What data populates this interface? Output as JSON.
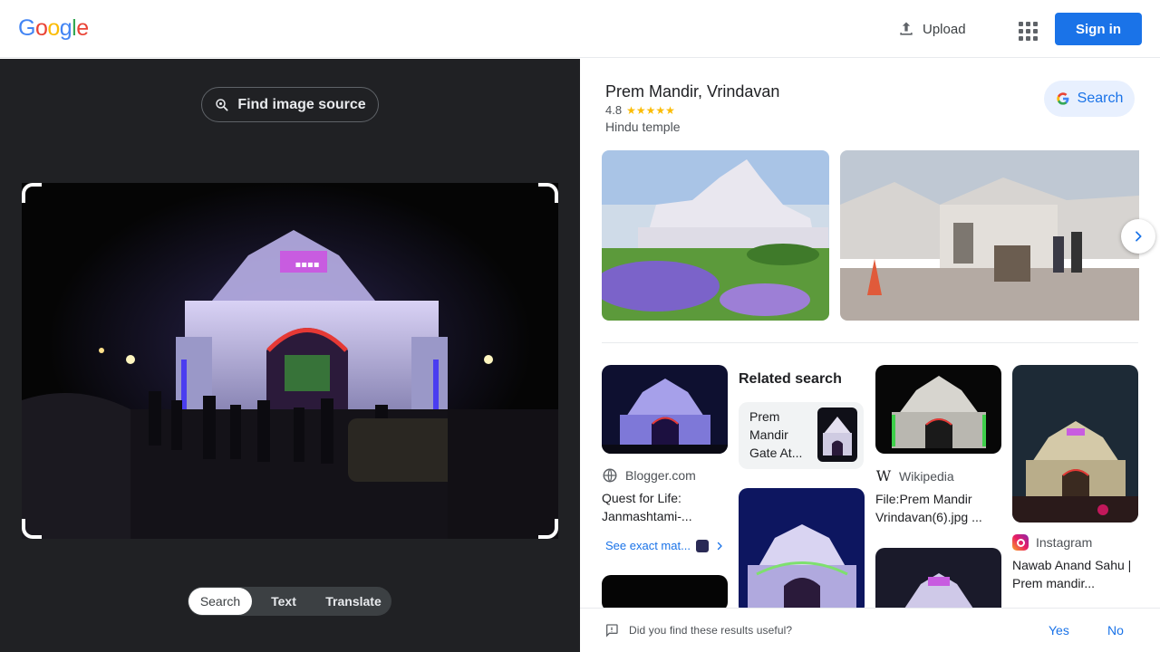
{
  "header": {
    "logo": "Google",
    "upload_label": "Upload",
    "signin_label": "Sign in"
  },
  "lens": {
    "find_source_label": "Find image source",
    "modes": [
      "Search",
      "Text",
      "Translate"
    ],
    "active_mode": "Search"
  },
  "knowledge": {
    "title": "Prem Mandir, Vrindavan",
    "rating": "4.8",
    "stars": "★★★★★",
    "category": "Hindu temple",
    "search_label": "Search"
  },
  "results": {
    "related_title": "Related search",
    "related_chip_label": "Prem Mandir Gate At...",
    "cards": [
      {
        "source": "Blogger.com",
        "title": "Quest for Life: Janmashtami-...",
        "exact": "See exact mat..."
      },
      {
        "source": "Wikipedia",
        "title": "File:Prem Mandir Vrindavan(6).jpg ..."
      },
      {
        "source": "Instagram",
        "title": "Nawab Anand Sahu | Prem mandir..."
      }
    ]
  },
  "feedback": {
    "question": "Did you find these results useful?",
    "yes": "Yes",
    "no": "No"
  },
  "colors": {
    "accent": "#1a73e8",
    "dark_panel": "#202124",
    "star": "#fbbc04"
  },
  "icons": [
    "upload-icon",
    "apps-grid-icon",
    "lens-search-icon",
    "google-g-icon",
    "chevron-right-icon",
    "blogger-globe-icon",
    "wikipedia-icon",
    "instagram-icon",
    "feedback-icon"
  ]
}
